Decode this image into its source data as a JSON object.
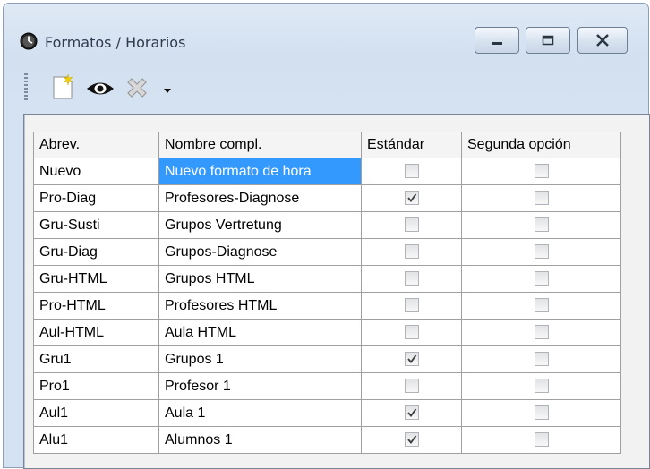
{
  "window": {
    "title": "Formatos / Horarios",
    "icon": "clock-icon"
  },
  "toolbar": {
    "items": [
      "new-document-icon",
      "eye-icon",
      "delete-icon",
      "dropdown-arrow-icon"
    ]
  },
  "table": {
    "columns": [
      "Abrev.",
      "Nombre compl.",
      "Estándar",
      "Segunda opción"
    ],
    "rows": [
      {
        "abrev": "Nuevo",
        "nombre": "Nuevo formato de hora",
        "estandar": false,
        "segunda": false
      },
      {
        "abrev": "Pro-Diag",
        "nombre": "Profesores-Diagnose",
        "estandar": true,
        "segunda": false
      },
      {
        "abrev": "Gru-Susti",
        "nombre": "Grupos Vertretung",
        "estandar": false,
        "segunda": false
      },
      {
        "abrev": "Gru-Diag",
        "nombre": "Grupos-Diagnose",
        "estandar": false,
        "segunda": false
      },
      {
        "abrev": "Gru-HTML",
        "nombre": "Grupos HTML",
        "estandar": false,
        "segunda": false
      },
      {
        "abrev": "Pro-HTML",
        "nombre": "Profesores HTML",
        "estandar": false,
        "segunda": false
      },
      {
        "abrev": "Aul-HTML",
        "nombre": "Aula HTML",
        "estandar": false,
        "segunda": false
      },
      {
        "abrev": "Gru1",
        "nombre": "Grupos 1",
        "estandar": true,
        "segunda": false
      },
      {
        "abrev": "Pro1",
        "nombre": "Profesor 1",
        "estandar": false,
        "segunda": false
      },
      {
        "abrev": "Aul1",
        "nombre": "Aula 1",
        "estandar": true,
        "segunda": false
      },
      {
        "abrev": "Alu1",
        "nombre": "Alumnos 1",
        "estandar": true,
        "segunda": false
      }
    ]
  },
  "colors": {
    "selection": "#3399ff",
    "grid": "#a0a0a0",
    "window_bg": "#d5e2f1"
  }
}
